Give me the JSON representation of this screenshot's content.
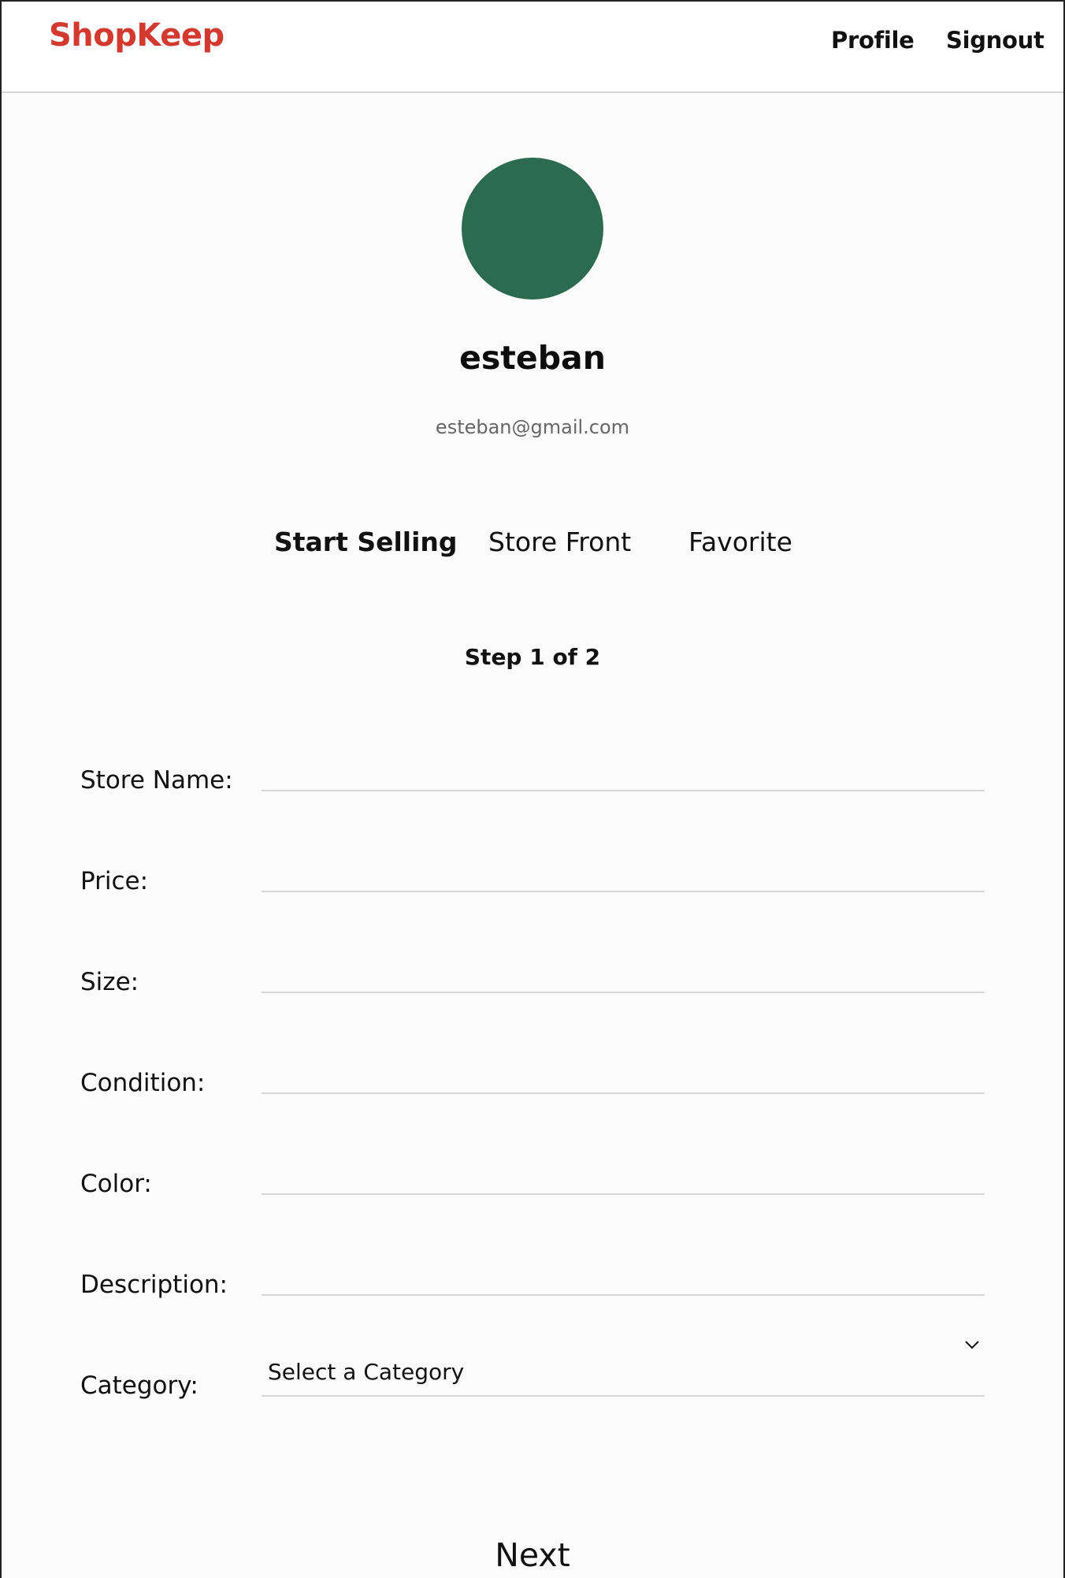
{
  "colors": {
    "brand": "#d23a2f",
    "avatar": "#2c6a51"
  },
  "header": {
    "logo": "ShopKeep",
    "nav": {
      "profile": "Profile",
      "signout": "Signout"
    }
  },
  "profile": {
    "username": "esteban",
    "email": "esteban@gmail.com"
  },
  "tabs": [
    {
      "label": "Start Selling",
      "active": true
    },
    {
      "label": "Store Front",
      "active": false
    },
    {
      "label": "Favorite",
      "active": false
    }
  ],
  "form": {
    "step": "Step 1 of 2",
    "fields": {
      "store_name": {
        "label": "Store Name:",
        "value": ""
      },
      "price": {
        "label": "Price:",
        "value": ""
      },
      "size": {
        "label": "Size:",
        "value": ""
      },
      "condition": {
        "label": "Condition:",
        "value": ""
      },
      "color": {
        "label": "Color:",
        "value": ""
      },
      "description": {
        "label": "Description:",
        "value": ""
      }
    },
    "category": {
      "label": "Category:",
      "selected": "Select a Category",
      "icon": "chevron-down-icon"
    },
    "next_label": "Next"
  }
}
